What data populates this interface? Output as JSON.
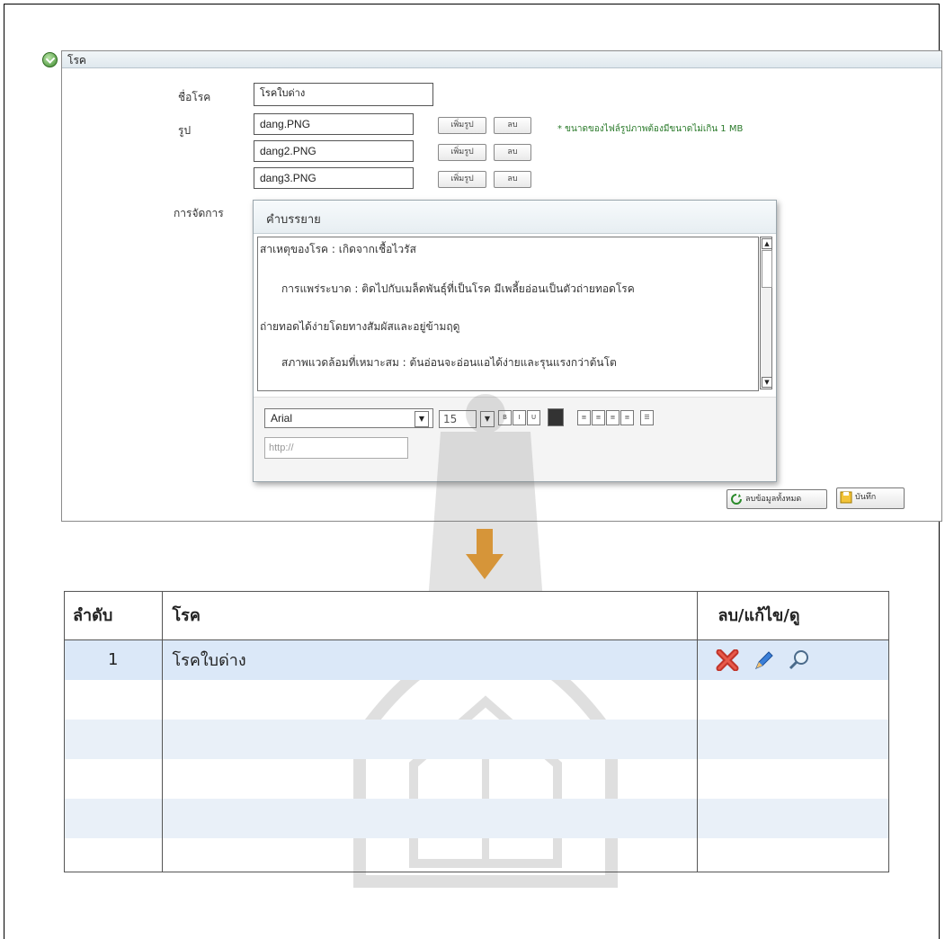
{
  "form": {
    "title": "โรค",
    "name_label": "ชื่อโรค",
    "name_value": "โรคใบด่าง",
    "image_label": "รูป",
    "images": [
      "dang.PNG",
      "dang2.PNG",
      "dang3.PNG"
    ],
    "add_image_label": "เพิ่มรูป",
    "delete_label": "ลบ",
    "note": "* ขนาดของไฟล์รูปภาพต้องมีขนาดไม่เกิน 1 MB",
    "manage_label": "การจัดการ",
    "clear_all_label": "ลบข้อมูลทั้งหมด",
    "save_label": "บันทึก"
  },
  "editor": {
    "title": "คำบรรยาย",
    "lines": [
      "สาเหตุของโรค : เกิดจากเชื้อไวรัส",
      "การแพร่ระบาด : ติดไปกับเมล็ดพันธุ์ที่เป็นโรค มีเพลี้ยอ่อนเป็นตัวถ่ายทอดโรค",
      "ถ่ายทอดได้ง่ายโดยทางสัมผัสและอยู่ข้ามฤดู",
      "สภาพแวดล้อมที่เหมาะสม : ต้นอ่อนจะอ่อนแอได้ง่ายและรุนแรงกว่าต้นโต"
    ],
    "font": "Arial",
    "font_size": "15",
    "url_placeholder": "http://"
  },
  "table": {
    "headers": [
      "ลำดับ",
      "โรค",
      "ลบ/แก้ไข/ดู"
    ],
    "rows": [
      {
        "index": "1",
        "name": "โรคใบด่าง"
      }
    ]
  },
  "icons": {
    "delete": "delete-icon",
    "edit": "edit-icon",
    "view": "view-icon"
  },
  "colors": {
    "accent_orange": "#f0a030",
    "note_green": "#2a7a2a",
    "selected_row": "#dbe8f8"
  }
}
